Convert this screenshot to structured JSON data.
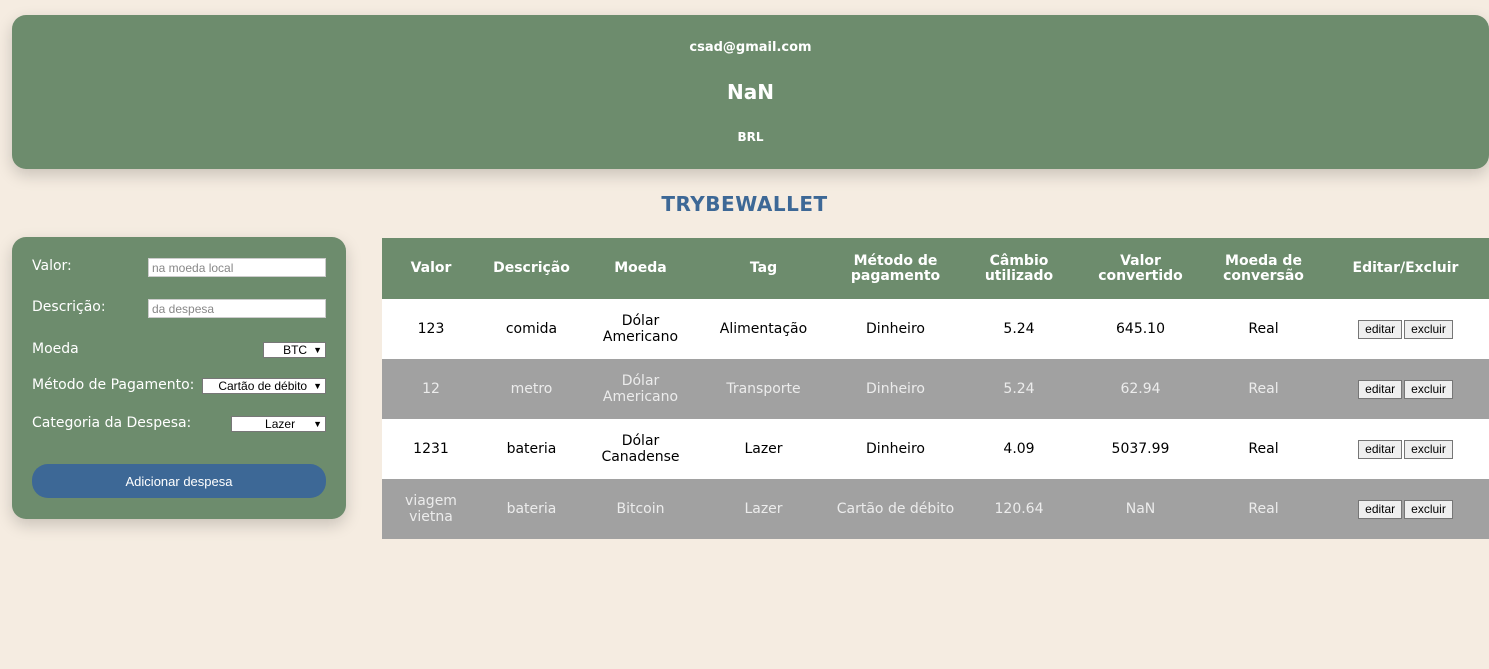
{
  "header": {
    "email": "csad@gmail.com",
    "total": "NaN",
    "currency": "BRL"
  },
  "brand": "TRYBEWALLET",
  "form": {
    "value_label": "Valor:",
    "value_placeholder": "na moeda local",
    "desc_label": "Descrição:",
    "desc_placeholder": "da despesa",
    "currency_label": "Moeda",
    "currency_selected": "BTC",
    "method_label": "Método de Pagamento:",
    "method_selected": "Cartão de débito",
    "tag_label": "Categoria da Despesa:",
    "tag_selected": "Lazer",
    "add_button": "Adicionar despesa"
  },
  "table": {
    "headers": [
      "Valor",
      "Descrição",
      "Moeda",
      "Tag",
      "Método de pagamento",
      "Câmbio utilizado",
      "Valor convertido",
      "Moeda de conversão",
      "Editar/Excluir"
    ],
    "edit_label": "editar",
    "delete_label": "excluir",
    "rows": [
      {
        "valor": "123",
        "descricao": "comida",
        "moeda": "Dólar Americano",
        "tag": "Alimentação",
        "metodo": "Dinheiro",
        "cambio": "5.24",
        "convertido": "645.10",
        "conversao": "Real"
      },
      {
        "valor": "12",
        "descricao": "metro",
        "moeda": "Dólar Americano",
        "tag": "Transporte",
        "metodo": "Dinheiro",
        "cambio": "5.24",
        "convertido": "62.94",
        "conversao": "Real"
      },
      {
        "valor": "1231",
        "descricao": "bateria",
        "moeda": "Dólar Canadense",
        "tag": "Lazer",
        "metodo": "Dinheiro",
        "cambio": "4.09",
        "convertido": "5037.99",
        "conversao": "Real"
      },
      {
        "valor": "viagem vietna",
        "descricao": "bateria",
        "moeda": "Bitcoin",
        "tag": "Lazer",
        "metodo": "Cartão de débito",
        "cambio": "120.64",
        "convertido": "NaN",
        "conversao": "Real"
      }
    ]
  },
  "colors": {
    "background": "#f5ece1",
    "panel_green": "#6d8c6d",
    "accent_blue": "#3d6896",
    "row_gray": "#a1a1a1"
  }
}
